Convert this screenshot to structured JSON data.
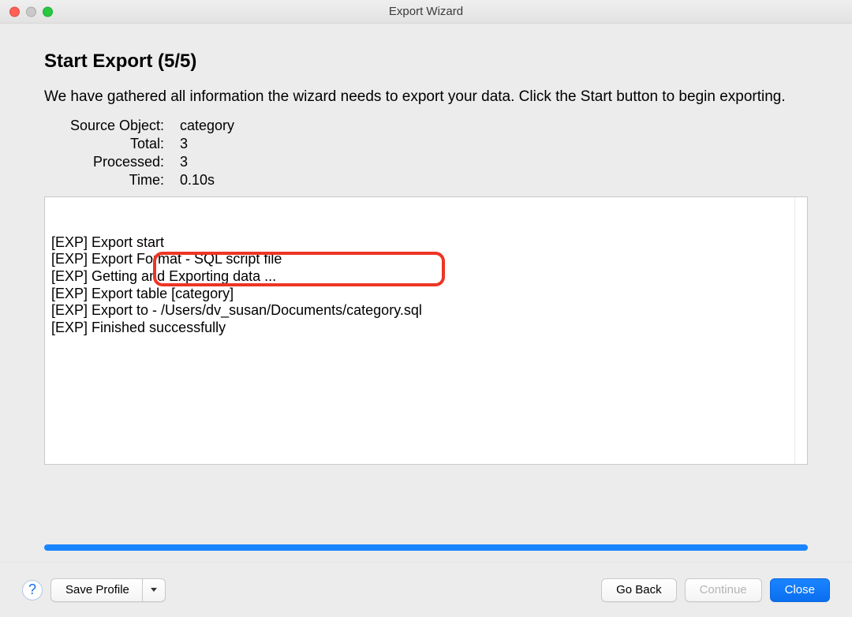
{
  "window": {
    "title": "Export Wizard"
  },
  "page": {
    "heading": "Start Export (5/5)",
    "description": "We have gathered all information the wizard needs to export your data. Click the Start button to begin exporting."
  },
  "summary": {
    "source_object_label": "Source Object:",
    "source_object_value": "category",
    "total_label": "Total:",
    "total_value": "3",
    "processed_label": "Processed:",
    "processed_value": "3",
    "time_label": "Time:",
    "time_value": "0.10s"
  },
  "log": {
    "lines": [
      "[EXP] Export start",
      "[EXP] Export Format - SQL script file",
      "[EXP] Getting and Exporting data ...",
      "[EXP] Export table [category]",
      "[EXP] Export to - /Users/dv_susan/Documents/category.sql",
      "[EXP] Finished successfully"
    ],
    "highlighted_path": "/Users/dv_susan/Documents/category.sql"
  },
  "progress": {
    "percent": 100
  },
  "footer": {
    "help_tooltip": "Help",
    "save_profile_label": "Save Profile",
    "go_back_label": "Go Back",
    "continue_label": "Continue",
    "close_label": "Close",
    "continue_enabled": false
  }
}
